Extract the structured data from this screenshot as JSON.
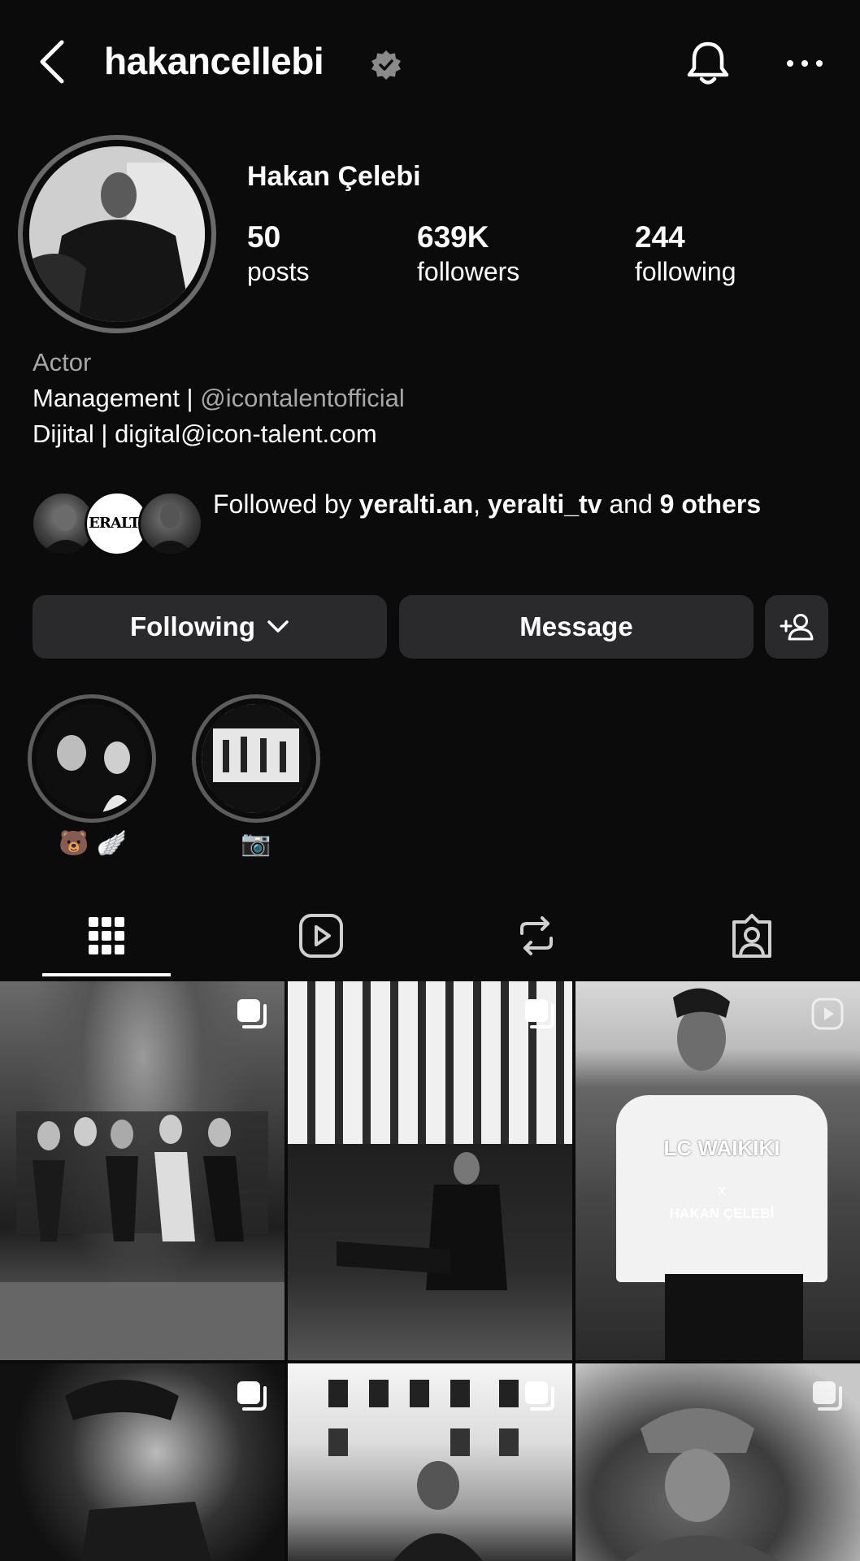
{
  "header": {
    "username": "hakancellebi",
    "verified_icon": "verified-badge-icon",
    "bell_icon": "bell-icon",
    "more_icon": "more-horizontal-icon"
  },
  "profile": {
    "display_name": "Hakan Çelebi",
    "stats": {
      "posts_count": "50",
      "posts_label": "posts",
      "followers_count": "639K",
      "followers_label": "followers",
      "following_count": "244",
      "following_label": "following"
    },
    "bio": {
      "category": "Actor",
      "line1_prefix": "Management | ",
      "line1_mention": "@icontalentofficial",
      "line2": "Dijital | digital@icon-talent.com"
    },
    "followed_by": {
      "prefix": "Followed by ",
      "user1": "yeralti.an",
      "separator": ", ",
      "user2": "yeralti_tv",
      "and": " and ",
      "others": "9 others",
      "avatar2_text": "ERALTI"
    }
  },
  "actions": {
    "following_label": "Following",
    "message_label": "Message",
    "add_user_icon": "add-person-icon"
  },
  "highlights": [
    {
      "label": "🐻 🪽"
    },
    {
      "label": "📷"
    }
  ],
  "tabs": [
    {
      "icon": "grid-icon",
      "active": true
    },
    {
      "icon": "reels-icon",
      "active": false
    },
    {
      "icon": "reposts-icon",
      "active": false
    },
    {
      "icon": "tagged-icon",
      "active": false
    }
  ],
  "grid": {
    "post3_brand": "LC WAIKIKI",
    "post3_x": "X",
    "post3_name": "HAKAN ÇELEBİ"
  },
  "colors": {
    "background": "#0b0b0c",
    "button_bg": "#2a2a2c",
    "secondary_text": "#a6a6a6"
  }
}
